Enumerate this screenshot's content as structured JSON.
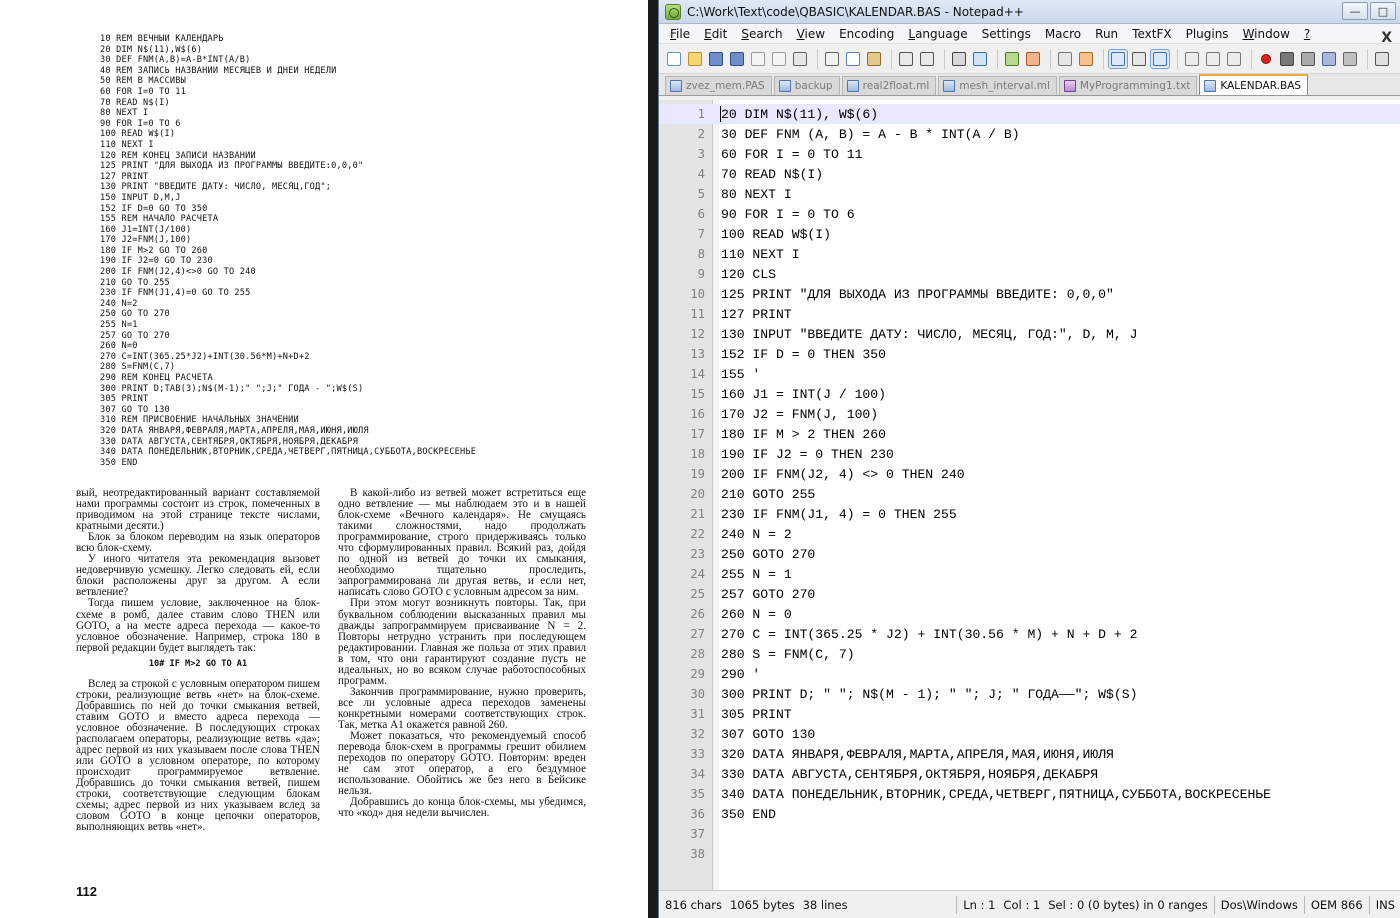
{
  "book": {
    "code_lines": [
      "10 REM ВЕЧНЫЙ КАЛЕНДАРЬ",
      "20 DIM N$(11),W$(6)",
      "30 DEF FNM(A,B)=A-B*INT(A/B)",
      "40 REM ЗАПИСЬ НАЗВАНИЙ МЕСЯЦЕВ И ДНЕЙ НЕДЕЛИ",
      "50 REM В МАССИВЫ",
      "60 FOR I=0 TO 11",
      "70 READ N$(I)",
      "80 NEXT I",
      "90 FOR I=0 TO 6",
      "100 READ W$(I)",
      "110 NEXT I",
      "120 REM КОНЕЦ ЗАПИСИ НАЗВАНИЙ",
      "125 PRINT \"ДЛЯ ВЫХОДА ИЗ ПРОГРАММЫ ВВЕДИТЕ:0,0,0\"",
      "127 PRINT",
      "130 PRINT \"ВВЕДИТЕ ДАТУ: ЧИСЛО, МЕСЯЦ,ГОД\";",
      "150 INPUT D,M,J",
      "152 IF D=0 GO TO 350",
      "155 REM НАЧАЛО РАСЧЕТА",
      "160 J1=INT(J/100)",
      "170 J2=FNM(J,100)",
      "180 IF M>2 GO TO 260",
      "190 IF J2=0 GO TO 230",
      "200 IF FNM(J2,4)<>0 GO TO 240",
      "210 GO TO 255",
      "230 IF FNM(J1,4)=0 GO TO 255",
      "240 N=2",
      "250 GO TO 270",
      "255 N=1",
      "257 GO TO 270",
      "260 N=0",
      "270 C=INT(365.25*J2)+INT(30.56*M)+N+D+2",
      "280 S=FNM(C,7)",
      "290 REM КОНЕЦ РАСЧЕТА",
      "300 PRINT D;TAB(3);N$(M-1);\" \";J;\" ГОДА - \";W$(S)",
      "305 PRINT",
      "307 GO TO 130",
      "310 REM ПРИСВОЕНИЕ НАЧАЛЬНЫХ ЗНАЧЕНИЙ",
      "320 DATA ЯНВАРЯ,ФЕВРАЛЯ,МАРТА,АПРЕЛЯ,МАЯ,ИЮНЯ,ИЮЛЯ",
      "330 DATA АВГУСТА,СЕНТЯБРЯ,ОКТЯБРЯ,НОЯБРЯ,ДЕКАБРЯ",
      "340 DATA ПОНЕДЕЛЬНИК,ВТОРНИК,СРЕДА,ЧЕТВЕРГ,ПЯТНИЦА,СУББОТА,ВОСКРЕСЕНЬЕ",
      "350 END"
    ],
    "left_column": [
      "вый, неотредактированный вариант составляемой нами программы состоит из строк, помеченных в приводимом на этой странице тексте числами, кратными десяти.)",
      "Блок за блоком переводим на язык операторов всю блок-схему.",
      "У иного читателя эта рекомендация вызовет недоверчивую усмешку. Легко следовать ей, если блоки расположены друг за другом. А если ветвление?",
      "Тогда пишем условие, заключенное на блок-схеме в ромб, далее ставим слово THEN или GOTO, а на месте адреса перехода — какое-то условное обозначение. Например, строка 180 в первой редакции будет выглядеть так:",
      "10# IF M>2 GO TO A1",
      "Вслед за строкой с условным оператором пишем строки, реализующие ветвь «нет» на блок-схеме. Добравшись по ней до точки смыкания ветвей, ставим GOTO и вместо адреса перехода — условное обозначение. В последующих строках располагаем операторы, реализующие ветвь «да»; адрес первой из них указываем после слова THEN или GOTO в условном операторе, по которому происходит программируемое ветвление. Добравшись до точки смыкания ветвей, пишем строки, соответствующие следующим блокам схемы; адрес первой из них указываем вслед за словом GOTO в конце цепочки операторов, выполняющих ветвь «нет»."
    ],
    "right_column": [
      "В какой-либо из ветвей может встретиться еще одно ветвление — мы наблюдаем это и в нашей блок-схеме «Вечного календаря». Не смущаясь такими сложностями, надо продолжать программирование, строго придерживаясь только что сформулированных правил. Всякий раз, дойдя по одной из ветвей до точки их смыкания, необходимо тщательно проследить, запрограммирована ли другая ветвь, и если нет, написать слово GOTO с условным адресом за ним.",
      "При этом могут возникнуть повторы. Так, при буквальном соблюдении высказанных правил мы дважды запрограммируем присваивание N = 2. Повторы нетрудно устранить при последующем редактировании. Главная же польза от этих правил в том, что они гарантируют создание пусть не идеальных, но во всяком случае работоспособных программ.",
      "Закончив программирование, нужно проверить, все ли условные адреса переходов заменены конкретными номерами соответствующих строк. Так, метка А1 окажется равной 260.",
      "Может показаться, что рекомендуемый способ перевода блок-схем в программы грешит обилием переходов по оператору GOTO. Повторим: вреден не сам этот оператор, а его бездумное использование. Обойтись же без него в Бейсике нельзя.",
      "Добравшись до конца блок-схемы, мы убедимся, что «код» дня недели вычислен."
    ],
    "page_number": "112"
  },
  "window": {
    "title": "C:\\Work\\Text\\code\\QBASIC\\KALENDAR.BAS - Notepad++",
    "minimize": "—",
    "maximize": "□"
  },
  "menu": {
    "items": [
      {
        "u": "F",
        "rest": "ile"
      },
      {
        "u": "E",
        "rest": "dit"
      },
      {
        "u": "S",
        "rest": "earch",
        "pre": ""
      },
      {
        "u": "V",
        "rest": "iew"
      },
      {
        "u": "",
        "rest": "Encoding"
      },
      {
        "u": "L",
        "rest": "anguage"
      },
      {
        "u": "",
        "rest": "Settings"
      },
      {
        "u": "",
        "rest": "Macro"
      },
      {
        "u": "",
        "rest": "Run"
      },
      {
        "u": "",
        "rest": "TextFX"
      },
      {
        "u": "",
        "rest": "Plugins"
      },
      {
        "u": "W",
        "rest": "indow"
      },
      {
        "u": "?",
        "rest": ""
      }
    ],
    "close": "X"
  },
  "tabs": [
    {
      "label": "zvez_mem.PAS",
      "active": false,
      "icon": "blue"
    },
    {
      "label": "backup",
      "active": false,
      "icon": "blue"
    },
    {
      "label": "real2float.ml",
      "active": false,
      "icon": "blue"
    },
    {
      "label": "mesh_interval.ml",
      "active": false,
      "icon": "blue"
    },
    {
      "label": "MyProgramming1.txt",
      "active": false,
      "icon": "purple"
    },
    {
      "label": "KALENDAR.BAS",
      "active": true,
      "icon": "blue"
    }
  ],
  "editor": {
    "lines": [
      "20 DIM N$(11), W$(6)",
      "30 DEF FNM (A, B) = A - B * INT(A / B)",
      "60 FOR I = 0 TO 11",
      "70 READ N$(I)",
      "80 NEXT I",
      "90 FOR I = 0 TO 6",
      "100 READ W$(I)",
      "110 NEXT I",
      "120 CLS",
      "125 PRINT \"ДЛЯ ВЫХОДА ИЗ ПРОГРАММЫ ВВЕДИТЕ: 0,0,0\"",
      "127 PRINT",
      "130 INPUT \"ВВЕДИТЕ ДАТУ: ЧИСЛО, МЕСЯЦ, ГОД:\", D, M, J",
      "152 IF D = 0 THEN 350",
      "155 '",
      "160 J1 = INT(J / 100)",
      "170 J2 = FNM(J, 100)",
      "180 IF M > 2 THEN 260",
      "190 IF J2 = 0 THEN 230",
      "200 IF FNM(J2, 4) <> 0 THEN 240",
      "210 GOTO 255",
      "230 IF FNM(J1, 4) = 0 THEN 255",
      "240 N = 2",
      "250 GOTO 270",
      "255 N = 1",
      "257 GOTO 270",
      "260 N = 0",
      "270 C = INT(365.25 * J2) + INT(30.56 * M) + N + D + 2",
      "280 S = FNM(C, 7)",
      "290 '",
      "300 PRINT D; \" \"; N$(M - 1); \" \"; J; \" ГОДА——\"; W$(S)",
      "305 PRINT",
      "307 GOTO 130",
      "320 DATA ЯНВАРЯ,ФЕВРАЛЯ,МАРТА,АПРЕЛЯ,МАЯ,ИЮНЯ,ИЮЛЯ",
      "330 DATA АВГУСТА,СЕНТЯБРЯ,ОКТЯБРЯ,НОЯБРЯ,ДЕКАБРЯ",
      "340 DATA ПОНЕДЕЛЬНИК,ВТОРНИК,СРЕДА,ЧЕТВЕРГ,ПЯТНИЦА,СУББОТА,ВОСКРЕСЕНЬЕ",
      "350 END",
      "",
      ""
    ],
    "current_line": 1
  },
  "status": {
    "chars": "816 chars",
    "bytes": "1065 bytes",
    "lines": "38 lines",
    "ln": "Ln : 1",
    "col": "Col : 1",
    "sel": "Sel : 0 (0 bytes) in 0 ranges",
    "eol": "Dos\\Windows",
    "encoding": "OEM 866",
    "mode": "INS"
  },
  "toolbar_icons": [
    "new-file-icon",
    "open-file-icon",
    "save-icon",
    "save-all-icon",
    "close-icon",
    "close-all-icon",
    "print-icon",
    "sep",
    "cut-icon",
    "copy-icon",
    "paste-icon",
    "sep",
    "undo-icon",
    "redo-icon",
    "sep",
    "find-icon",
    "replace-icon",
    "sep",
    "zoom-in-icon",
    "zoom-out-icon",
    "sep",
    "sync-v-icon",
    "sync-h-icon",
    "sep",
    "wrap-icon",
    "all-chars-icon",
    "indent-guide-icon",
    "sep",
    "udl-icon",
    "doc-map-icon",
    "function-list-icon",
    "sep",
    "record-macro-icon",
    "stop-macro-icon",
    "play-macro-icon",
    "run-macro-multiple-icon",
    "save-macro-icon",
    "sep",
    "spellcheck-icon"
  ],
  "colors": {
    "current_line_bg": "#e8e8ff",
    "active_tab_accent": "#f2a93b",
    "line_number": "#808080"
  }
}
